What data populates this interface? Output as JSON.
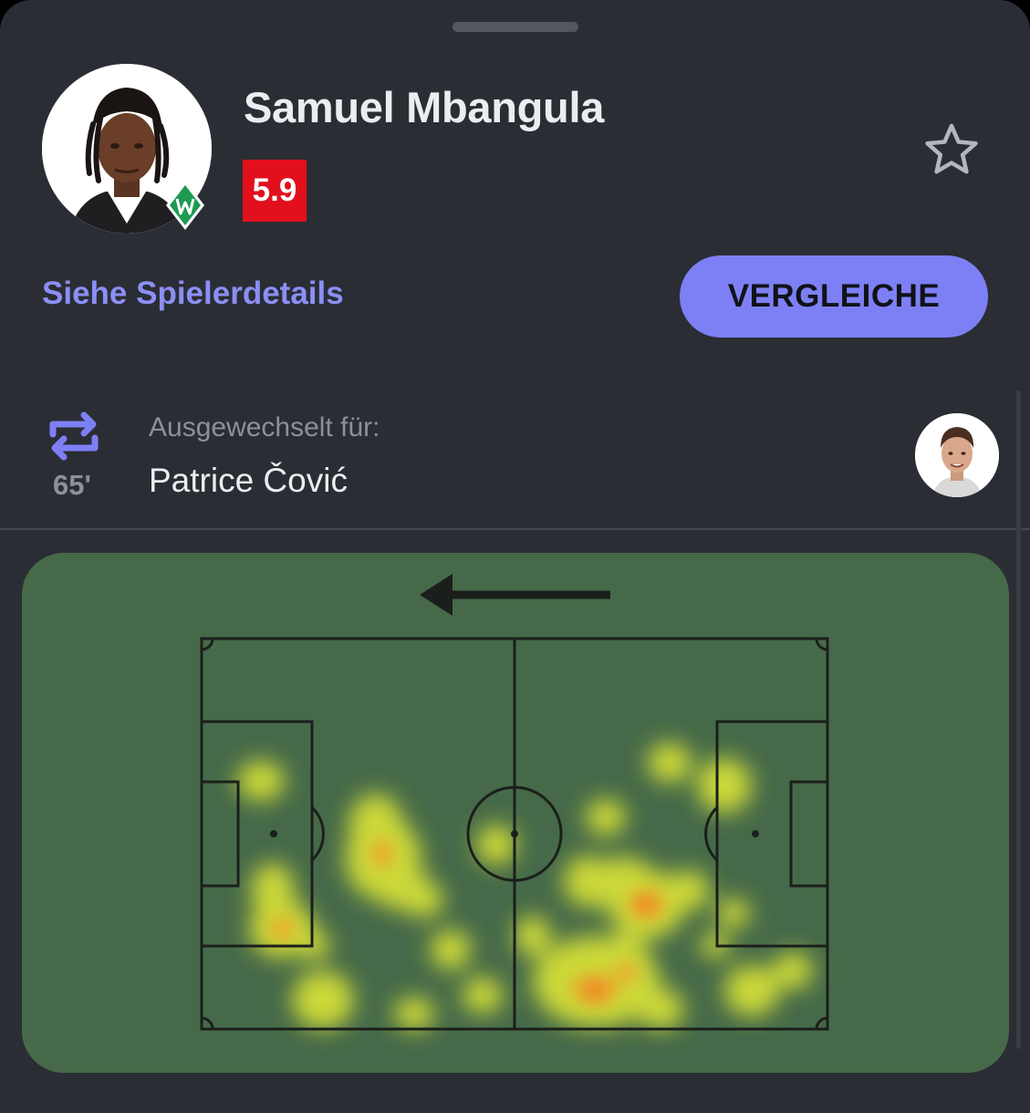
{
  "player": {
    "name": "Samuel Mbangula",
    "rating": "5.9",
    "rating_color": "#e2101c",
    "avatar_icon": "player-photo",
    "club_icon": "werder-bremen-badge",
    "favorite_icon": "star-outline-icon"
  },
  "actions": {
    "details_link": "Siehe Spielerdetails",
    "compare_button": "VERGLEICHE",
    "accent_color": "#7d80f4"
  },
  "substitution": {
    "icon": "substitution-swap-icon",
    "minute": "65'",
    "label": "Ausgewechselt für:",
    "player": "Patrice Čović"
  },
  "heatmap": {
    "attack_direction": "left",
    "pitch_color": "#466a49"
  }
}
